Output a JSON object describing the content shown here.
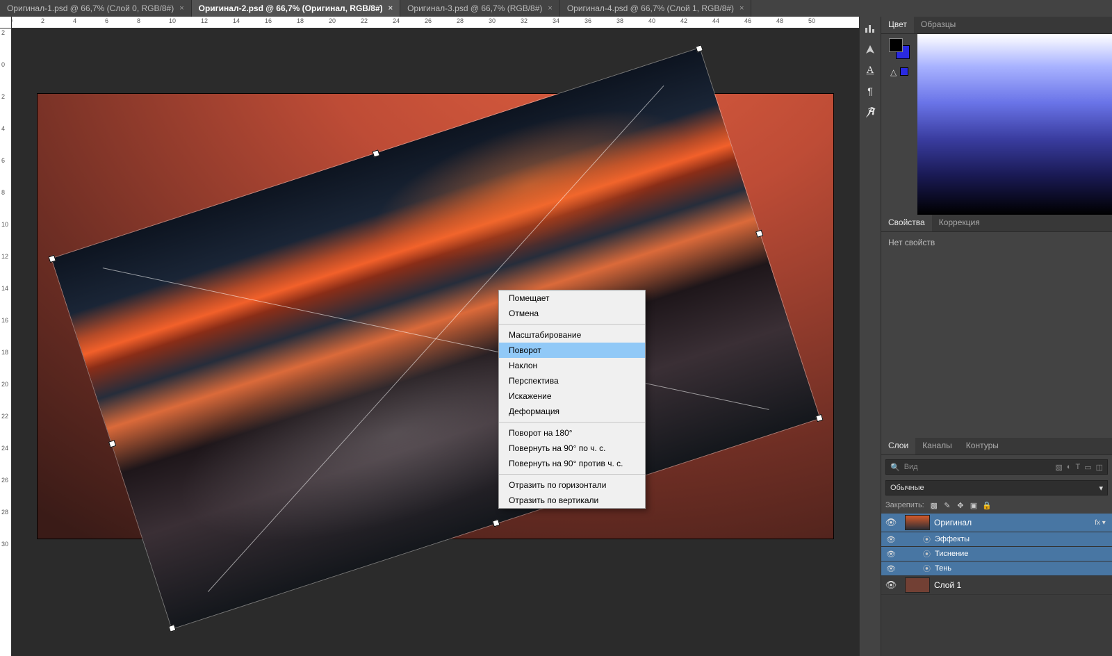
{
  "tabs": [
    {
      "label": "Оригинал-1.psd @ 66,7% (Слой 0, RGB/8#)",
      "active": false
    },
    {
      "label": "Оригинал-2.psd @ 66,7% (Оригинал, RGB/8#)",
      "active": true
    },
    {
      "label": "Оригинал-3.psd @ 66,7% (RGB/8#)",
      "active": false
    },
    {
      "label": "Оригинал-4.psd @ 66,7% (Слой 1, RGB/8#)",
      "active": false
    }
  ],
  "ruler_h": [
    "0",
    "2",
    "4",
    "6",
    "8",
    "10",
    "12",
    "14",
    "16",
    "18",
    "20",
    "22",
    "24",
    "26",
    "28",
    "30",
    "32",
    "34",
    "36",
    "38",
    "40",
    "42",
    "44",
    "46",
    "48",
    "50"
  ],
  "ruler_v": [
    "2",
    "0",
    "2",
    "4",
    "6",
    "8",
    "10",
    "12",
    "14",
    "16",
    "18",
    "20",
    "22",
    "24",
    "26",
    "28",
    "30"
  ],
  "context_menu": {
    "items": [
      {
        "label": "Помещает"
      },
      {
        "label": "Отмена"
      },
      {
        "sep": true
      },
      {
        "label": "Масштабирование"
      },
      {
        "label": "Поворот",
        "hl": true
      },
      {
        "label": "Наклон"
      },
      {
        "label": "Перспектива"
      },
      {
        "label": "Искажение"
      },
      {
        "label": "Деформация"
      },
      {
        "sep": true
      },
      {
        "label": "Поворот на 180°"
      },
      {
        "label": "Повернуть на 90° по ч. с."
      },
      {
        "label": "Повернуть на 90° против ч. с."
      },
      {
        "sep": true
      },
      {
        "label": "Отразить по горизонтали"
      },
      {
        "label": "Отразить по вертикали"
      }
    ]
  },
  "panels": {
    "color": {
      "tab1": "Цвет",
      "tab2": "Образцы"
    },
    "properties": {
      "tab1": "Свойства",
      "tab2": "Коррекция",
      "empty": "Нет свойств"
    },
    "layers": {
      "tab1": "Слои",
      "tab2": "Каналы",
      "tab3": "Контуры",
      "search_placeholder": "Вид",
      "blendmode": "Обычные",
      "lock_label": "Закрепить:",
      "items": [
        {
          "name": "Оригинал",
          "sel": true,
          "fx": "fx",
          "thumb": "img",
          "children": [
            {
              "name": "Эффекты"
            },
            {
              "name": "Тиснение"
            },
            {
              "name": "Тень"
            }
          ]
        },
        {
          "name": "Слой 1",
          "sel": false,
          "thumb": "bg"
        }
      ]
    }
  },
  "sidebar_icons": [
    "histogram",
    "navigator",
    "character",
    "paragraph",
    "glyphs"
  ]
}
